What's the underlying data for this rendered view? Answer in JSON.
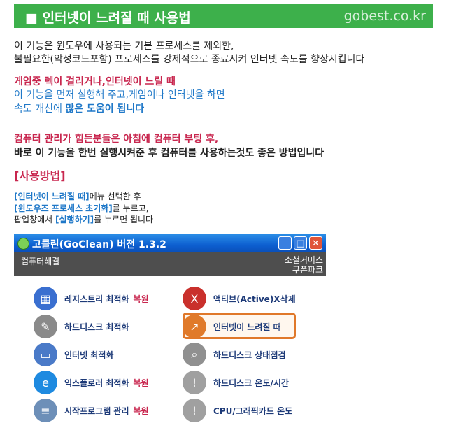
{
  "banner": {
    "title": "■ 인터넷이 느려질 때 사용법",
    "site": "gobest.co.kr"
  },
  "intro": [
    "이 기능은 윈도우에 사용되는 기본 프로세스를 제외한,",
    "불필요한(악성코드포함) 프로세스를 강제적으로 종료시켜 인터넷 속도를 향상시킵니다"
  ],
  "para2": {
    "red": "게임중 렉이 걸리거나,인터넷이 느릴 때",
    "line2": "이 기능을 먼저 실행해 주고,게임이나 인터넷을 하면",
    "line3a": "속도 개선에 ",
    "line3b": "많은 도움이 됩니다"
  },
  "para3": {
    "red": "컴퓨터 관리가 힘든분들은 아침에 컴퓨터 부팅 후,",
    "black": "바로 이 기능을 한번 실행시켜준 후 컴퓨터를 사용하는것도 좋은 방법입니다"
  },
  "usage": {
    "heading": "[사용방법]",
    "s1a": "[인터넷이 느려질 때]",
    "s1b": "메뉴 선택한 후",
    "s2a": "[윈도우즈 프로세스 초기화]",
    "s2b": "를 누르고,",
    "s3a": "팝업창에서 ",
    "s3b": "[실행하기]",
    "s3c": "를 누르면 됩니다"
  },
  "window": {
    "title": "고클린(GoClean) 버전 1.3.2",
    "menu_left": "컴퓨터해결",
    "menu_right_1": "소셜커머스",
    "menu_right_2": "쿠폰파크",
    "items": [
      {
        "label": "레지스트리 최적화",
        "tag": "복원",
        "icon": "registry-cube-icon",
        "color": "#3a6fd0"
      },
      {
        "label": "액티브(Active)X삭제",
        "tag": "",
        "icon": "activex-icon",
        "color": "#c9302c"
      },
      {
        "label": "하드디스크 최적화",
        "tag": "",
        "icon": "wrench-disk-icon",
        "color": "#8a8a8a"
      },
      {
        "label": "인터넷이 느려질 때",
        "tag": "",
        "icon": "speed-arrow-icon",
        "color": "#e07a2a"
      },
      {
        "label": "인터넷 최적화",
        "tag": "",
        "icon": "network-pc-icon",
        "color": "#4a7ac8"
      },
      {
        "label": "하드디스크 상태점검",
        "tag": "",
        "icon": "magnifier-icon",
        "color": "#909090"
      },
      {
        "label": "익스플로러 최적화",
        "tag": "복원",
        "icon": "ie-icon",
        "color": "#1e8ae0"
      },
      {
        "label": "하드디스크 온도/시간",
        "tag": "",
        "icon": "thermometer-icon",
        "color": "#a0a0a0"
      },
      {
        "label": "시작프로그램 관리",
        "tag": "복원",
        "icon": "document-icon",
        "color": "#6d8fb8"
      },
      {
        "label": "CPU/그래픽카드 온도",
        "tag": "",
        "icon": "cpu-thermometer-icon",
        "color": "#a0a0a0"
      }
    ]
  }
}
